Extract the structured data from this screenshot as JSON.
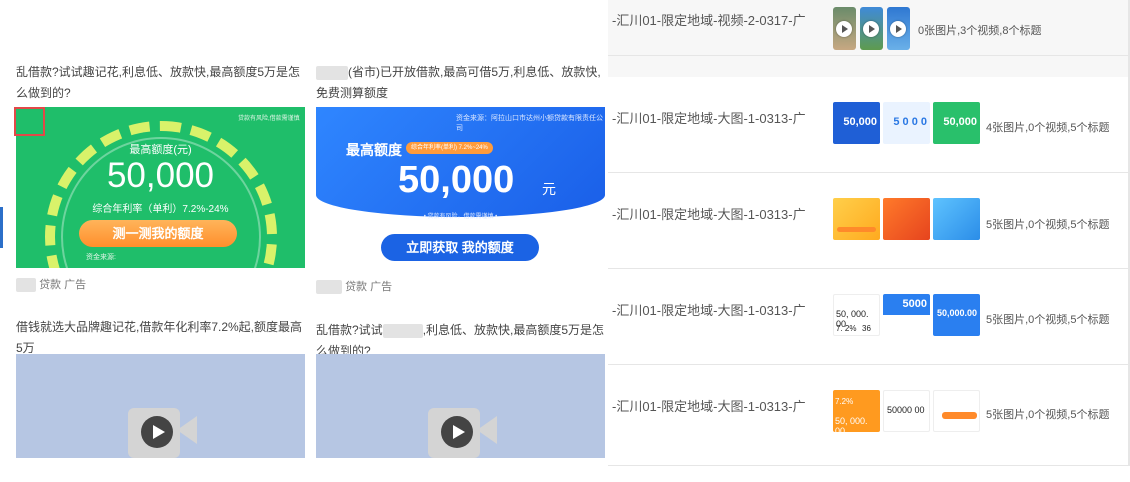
{
  "table": {
    "rows": [
      {
        "name": "-汇川01-限定地域-视频-2-0317-广",
        "summary": "0张图片,3个视频,8个标题",
        "type": "video"
      },
      {
        "name": "-汇川01-限定地域-大图-1-0313-广",
        "summary": "4张图片,0个视频,5个标题",
        "type": "image"
      },
      {
        "name": "-汇川01-限定地域-大图-1-0313-广",
        "summary": "5张图片,0个视频,5个标题",
        "type": "image"
      },
      {
        "name": "-汇川01-限定地域-大图-1-0313-广",
        "summary": "5张图片,0个视频,5个标题",
        "type": "image"
      },
      {
        "name": "-汇川01-限定地域-大图-1-0313-广",
        "summary": "5张图片,0个视频,5个标题",
        "type": "image"
      }
    ]
  },
  "ads": [
    {
      "title": "乱借款?试试趣记花,利息低、放款快,最高额度5万是怎么做到的?",
      "banner": {
        "corner_left": "贷款有风险,借款需谨慎",
        "label": "最高额度(元)",
        "amount": "50,000",
        "rate": "综合年利率（单利）7.2%-24%",
        "button": "测一测我的额度",
        "source": "资金来源:"
      },
      "footer": "贷款  广告"
    },
    {
      "title_suffix": "(省市)已开放借款,最高可借5万,利息低、放款快,免费测算额度",
      "banner": {
        "source": "资金来源：阿拉山口市达州小额贷款有限责任公司",
        "label": "最高额度",
        "rate_tag": "综合年利率(单利) 7.2%~24%",
        "amount": "50,000",
        "unit": "元",
        "note": "• 贷款有风险，借款需谨慎 •",
        "button": "立即获取 我的额度"
      },
      "footer": "贷款  广告"
    },
    {
      "title": "借钱就选大品牌趣记花,借款年化利率7.2%起,额度最高5万"
    },
    {
      "title_prefix": "乱借款?试试",
      "title_suffix": ",利息低、放款快,最高额度5万是怎么做到的?"
    }
  ],
  "colors": {
    "green": "#1fbe6a",
    "blue": "#1b63e4",
    "orange": "#ff8f2c",
    "accent": "#2b6fc9"
  },
  "thumbs": {
    "row2": [
      "50,000",
      "5 0 0 0",
      "50,000"
    ],
    "row4": [
      "50, 000. 00",
      "5000",
      "50,000.00"
    ],
    "row4_extra": "7. 2%",
    "row4_extra2": "36",
    "row5": [
      "50, 000. 00",
      "50000 00",
      "7.2%"
    ]
  }
}
